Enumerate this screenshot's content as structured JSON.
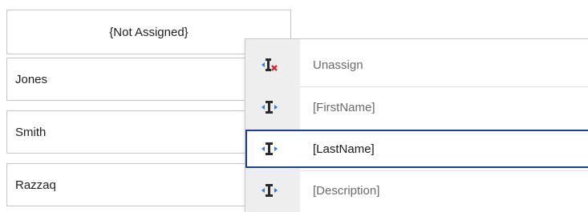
{
  "cells": {
    "header": "{Not Assigned}",
    "rows": [
      "Jones",
      "Smith",
      "Razzaq"
    ]
  },
  "menu": {
    "items": [
      {
        "label": "Unassign",
        "icon": "unassign-field-icon"
      },
      {
        "label": "[FirstName]",
        "icon": "field-icon"
      },
      {
        "label": "[LastName]",
        "icon": "field-icon",
        "selected": true
      },
      {
        "label": "[Description]",
        "icon": "field-icon"
      }
    ]
  },
  "colors": {
    "selection_border": "#1e3f8a",
    "icon_blue": "#3a78c8",
    "icon_dark": "#2a2a2a",
    "remove_red": "#d12b2b"
  }
}
